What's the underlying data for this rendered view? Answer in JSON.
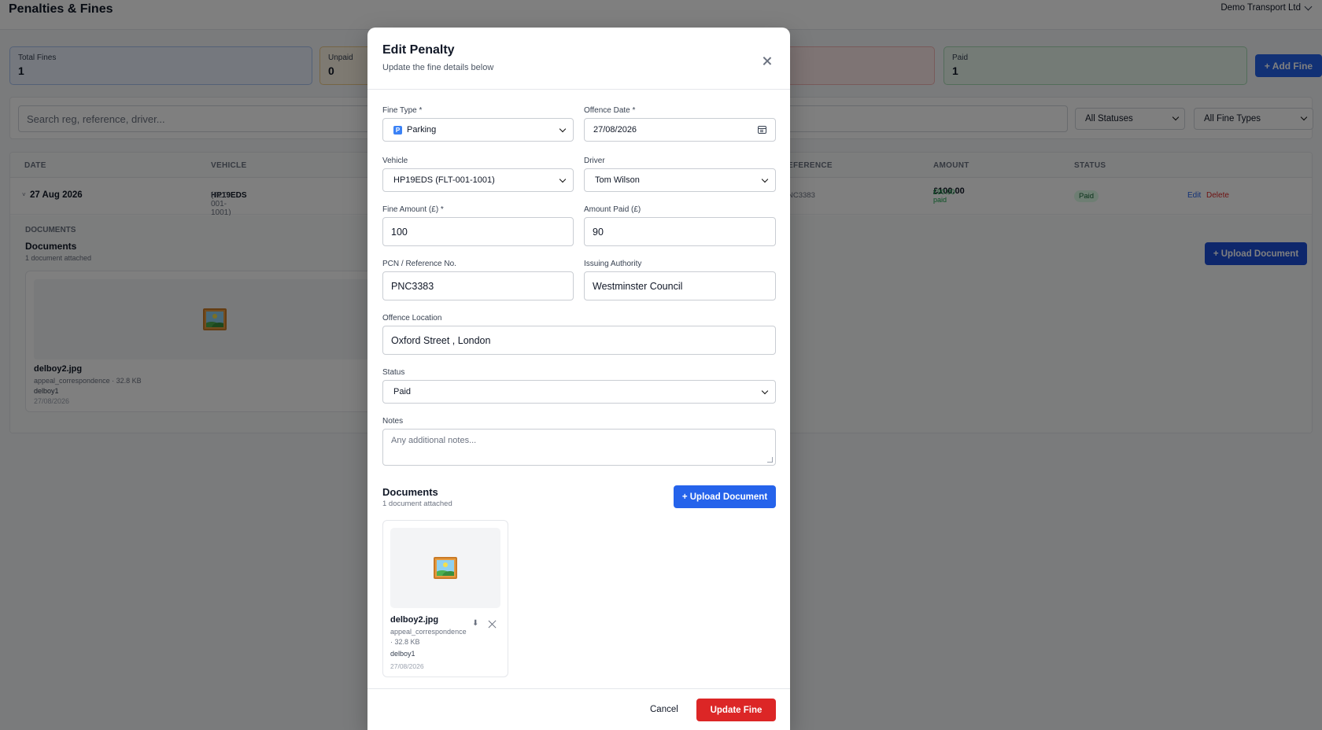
{
  "page": {
    "title": "Penalties & Fines",
    "company": "Demo Transport Ltd"
  },
  "stats": {
    "total": {
      "label": "Total Fines",
      "value": "1"
    },
    "unpaid": {
      "label": "Unpaid",
      "value": "0"
    },
    "paid": {
      "label": "Paid",
      "value": "1"
    }
  },
  "toolbar": {
    "add_fine": "+ Add Fine",
    "search_placeholder": "Search reg, reference, driver...",
    "status_filter": "All Statuses",
    "type_filter": "All Fine Types"
  },
  "table": {
    "headers": {
      "date": "DATE",
      "vehicle": "VEHICLE",
      "reference": "EFERENCE",
      "amount": "AMOUNT",
      "status": "STATUS"
    },
    "row": {
      "expander": "˅",
      "date": "27 Aug 2026",
      "reg": "HP19EDS",
      "fleet": "(FLT-001-1001)",
      "reference": "NC3383",
      "amount": "£100.00",
      "paid_sub": "£90.00 paid",
      "status": "Paid",
      "edit": "Edit",
      "delete": "Delete"
    },
    "documents": {
      "section_label": "DOCUMENTS",
      "title": "Documents",
      "count": "1 document attached",
      "upload": "+ Upload Document",
      "file": {
        "name": "delboy2.jpg",
        "meta": "appeal_correspondence · 32.8 KB",
        "uploaded_by": "delboy1",
        "date": "27/08/2026"
      }
    }
  },
  "modal": {
    "title": "Edit Penalty",
    "subtitle": "Update the fine details below",
    "fields": {
      "fine_type": {
        "label": "Fine Type *",
        "value": "Parking",
        "badge": "P"
      },
      "offence_date": {
        "label": "Offence Date *",
        "value": "27/08/2026"
      },
      "vehicle": {
        "label": "Vehicle",
        "value": "HP19EDS (FLT-001-1001)"
      },
      "driver": {
        "label": "Driver",
        "value": "Tom Wilson"
      },
      "fine_amount": {
        "label": "Fine Amount (£) *",
        "value": "100"
      },
      "amount_paid": {
        "label": "Amount Paid (£)",
        "value": "90"
      },
      "pcn": {
        "label": "PCN / Reference No.",
        "value": "PNC3383"
      },
      "authority": {
        "label": "Issuing Authority",
        "value": "Westminster Council"
      },
      "location": {
        "label": "Offence Location",
        "value": "Oxford Street , London"
      },
      "status": {
        "label": "Status",
        "value": "Paid"
      },
      "notes": {
        "label": "Notes",
        "placeholder": "Any additional notes..."
      }
    },
    "documents": {
      "title": "Documents",
      "count": "1 document attached",
      "upload": "+ Upload Document",
      "file": {
        "name": "delboy2.jpg",
        "meta": "appeal_correspondence · 32.8 KB",
        "uploaded_by": "delboy1",
        "date": "27/08/2026"
      }
    },
    "footer": {
      "cancel": "Cancel",
      "submit": "Update Fine"
    }
  },
  "colors": {
    "primary": "#2563eb",
    "danger": "#dc2626",
    "success": "#16a34a"
  }
}
